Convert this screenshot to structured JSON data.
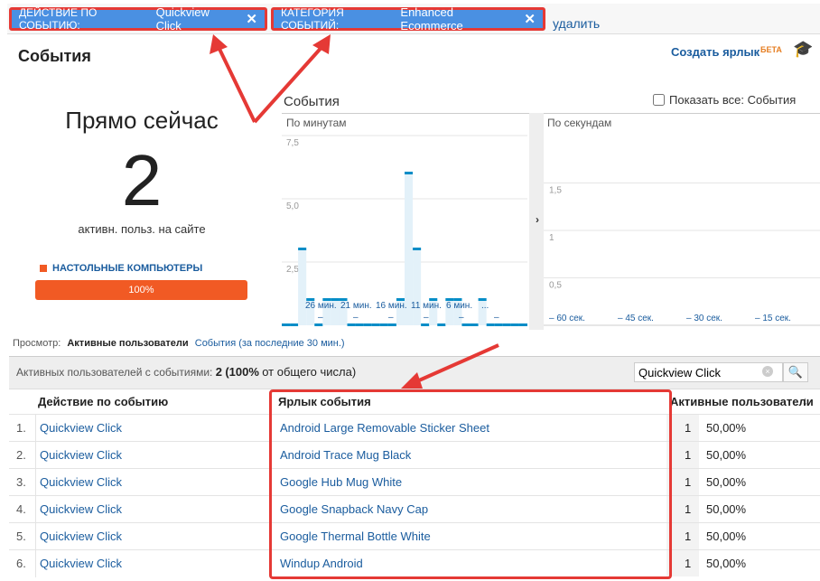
{
  "filters": [
    {
      "label": "ДЕЙСТВИЕ ПО СОБЫТИЮ:",
      "value": "Quickview Click"
    },
    {
      "label": "КАТЕГОРИЯ СОБЫТИЙ:",
      "value": "Enhanced Ecommerce"
    }
  ],
  "remove_label": "удалить",
  "page_title": "События",
  "create_shortcut": "Создать ярлык",
  "beta": "БЕТА",
  "now": {
    "title": "Прямо сейчас",
    "count": "2",
    "caption": "активн. польз. на сайте",
    "device": "НАСТОЛЬНЫЕ КОМПЬЮТЕРЫ",
    "device_pct": "100%",
    "device_fraction": 1.0,
    "accent": "#f15a24"
  },
  "chart_title": "События",
  "show_all": "Показать все: События",
  "chart_data": [
    {
      "type": "bar",
      "title": "По минутам",
      "ylim": [
        0,
        7.5
      ],
      "yticks": [
        "2,5",
        "5,0",
        "7,5"
      ],
      "ytick_values": [
        2.5,
        5,
        7.5
      ],
      "xtick_labels": [
        "26 мин.",
        "21 мин.",
        "16 мин.",
        "11 мин.",
        "6 мин.",
        "..."
      ],
      "values": [
        0,
        0,
        3,
        1,
        0,
        1,
        1,
        1,
        0,
        0,
        0,
        0,
        0,
        0,
        1,
        6,
        3,
        0,
        1,
        0,
        1,
        1,
        0,
        0,
        1,
        0,
        0,
        0,
        0,
        0
      ],
      "color": "#058dc7"
    },
    {
      "type": "bar",
      "title": "По секундам",
      "ylim": [
        0,
        2
      ],
      "yticks": [
        "0,5",
        "1",
        "1,5"
      ],
      "ytick_values": [
        0.5,
        1,
        1.5
      ],
      "xtick_labels": [
        "– 60 сек.",
        "– 45 сек.",
        "– 30 сек.",
        "– 15 сек."
      ],
      "values": []
    }
  ],
  "view": {
    "label": "Просмотр:",
    "tab_active": "Активные пользователи",
    "tab_other": "События (за последние 30 мин.)"
  },
  "summary": {
    "text": "Активных пользователей с событиями:",
    "count": "2",
    "pct": "(100%",
    "rest": "от общего числа)"
  },
  "search": {
    "value": "Quickview Click"
  },
  "table": {
    "headers": [
      "Действие по событию",
      "Ярлык события",
      "Активные пользователи"
    ],
    "rows": [
      {
        "n": "1.",
        "action": "Quickview Click",
        "label": "Android Large Removable Sticker Sheet",
        "users": "1",
        "pct": "50,00%"
      },
      {
        "n": "2.",
        "action": "Quickview Click",
        "label": "Android Trace Mug Black",
        "users": "1",
        "pct": "50,00%"
      },
      {
        "n": "3.",
        "action": "Quickview Click",
        "label": "Google Hub Mug White",
        "users": "1",
        "pct": "50,00%"
      },
      {
        "n": "4.",
        "action": "Quickview Click",
        "label": "Google Snapback Navy Cap",
        "users": "1",
        "pct": "50,00%"
      },
      {
        "n": "5.",
        "action": "Quickview Click",
        "label": "Google Thermal Bottle White",
        "users": "1",
        "pct": "50,00%"
      },
      {
        "n": "6.",
        "action": "Quickview Click",
        "label": "Windup Android",
        "users": "1",
        "pct": "50,00%"
      }
    ]
  }
}
